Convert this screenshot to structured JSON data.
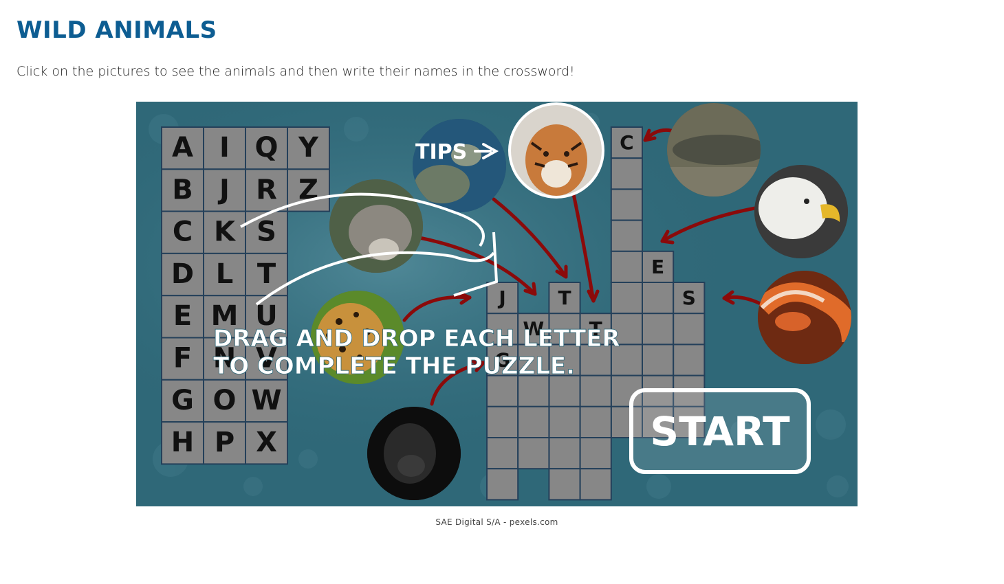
{
  "page": {
    "title": "WILD ANIMALS",
    "instruction": "Click on the pictures to see the animals and then write their names in the crossword!"
  },
  "game": {
    "letter_bank": [
      "A",
      "I",
      "Q",
      "Y",
      "B",
      "J",
      "R",
      "Z",
      "C",
      "K",
      "S",
      "D",
      "L",
      "T",
      "E",
      "M",
      "U",
      "F",
      "N",
      "V",
      "G",
      "O",
      "W",
      "H",
      "P",
      "X"
    ],
    "tips_label": "TIPS",
    "instructions_line1": "DRAG AND DROP EACH LETTER",
    "instructions_line2": "TO COMPLETE THE PUZZLE.",
    "start_label": "START",
    "crossword_letters": [
      "C",
      "E",
      "S",
      "J",
      "T",
      "W",
      "T",
      "G"
    ],
    "animals": [
      "tiger",
      "turtle",
      "wolf",
      "jaguar",
      "gorilla",
      "crocodile",
      "eagle",
      "snake"
    ]
  },
  "credit": "SAE Digital S/A - pexels.com"
}
